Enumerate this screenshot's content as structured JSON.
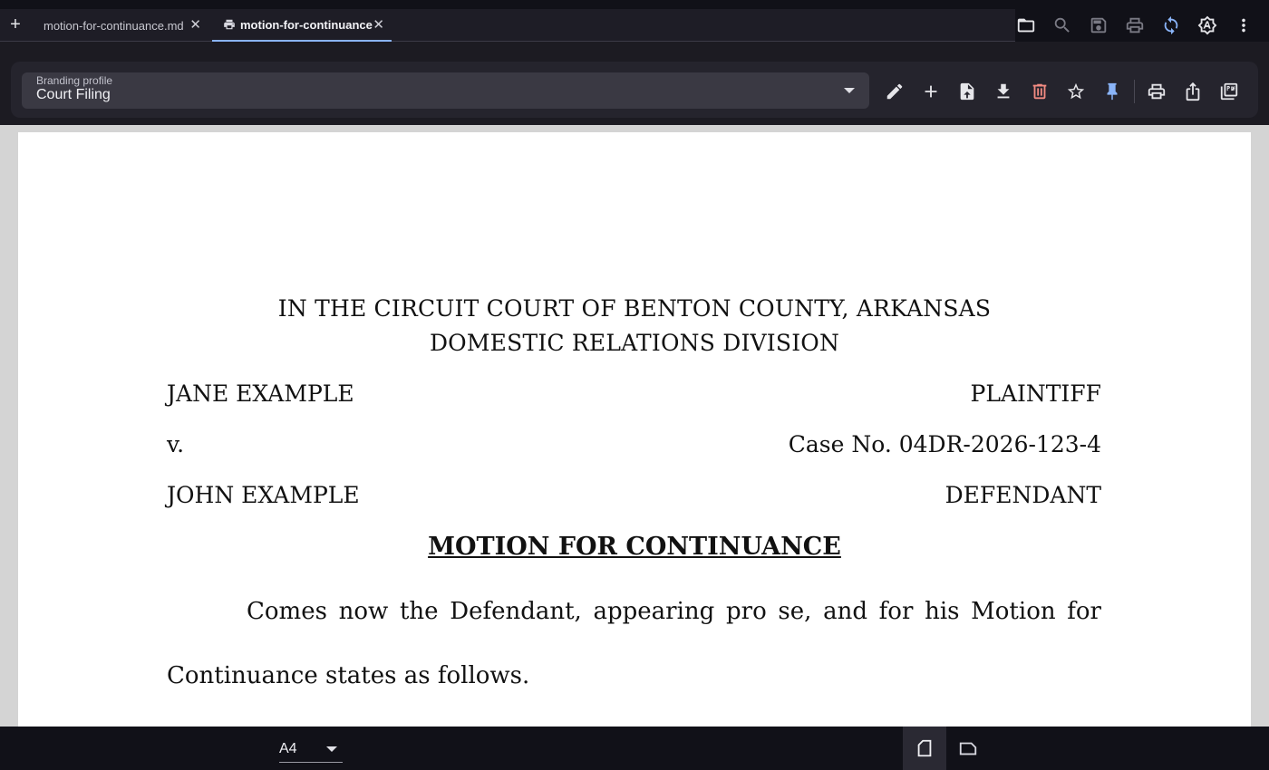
{
  "tabs": [
    {
      "label": "motion-for-continuance.md",
      "icon": "none"
    },
    {
      "label": "motion-for-continuance",
      "icon": "print-icon"
    }
  ],
  "top_toolbar": {
    "icons": [
      "folder-icon",
      "search-icon",
      "save-icon",
      "print-icon",
      "sync-icon",
      "theme-icon",
      "more-vert-icon"
    ]
  },
  "branding": {
    "label": "Branding profile",
    "selected": "Court Filing",
    "tools": [
      "edit-icon",
      "add-icon",
      "upload-file-icon",
      "download-icon",
      "delete-icon",
      "star-icon",
      "pin-icon",
      "print-icon",
      "share-icon",
      "pdf-icon"
    ]
  },
  "document": {
    "court_line1": "IN THE CIRCUIT COURT OF BENTON COUNTY, ARKANSAS",
    "court_line2": "DOMESTIC RELATIONS DIVISION",
    "plaintiff_name": "JANE EXAMPLE",
    "plaintiff_role": "PLAINTIFF",
    "versus": "v.",
    "case_no": "Case No. 04DR-2026-123-4",
    "defendant_name": "JOHN EXAMPLE",
    "defendant_role": "DEFENDANT",
    "title": "MOTION FOR CONTINUANCE",
    "para_line1": "Comes now the Defendant, appearing pro se, and for his Motion for",
    "para_line2": "Continuance states as follows."
  },
  "bottom": {
    "page_size": "A4"
  },
  "colors": {
    "accent": "#8ab4f8",
    "delete": "#f28b82",
    "sync": "#8ab4f8"
  }
}
